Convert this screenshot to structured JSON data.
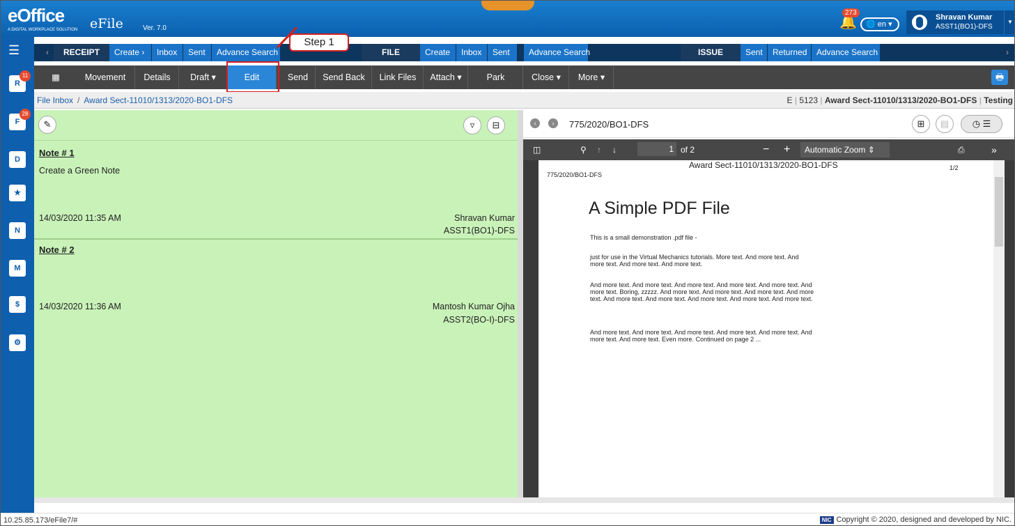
{
  "app": {
    "logo_text": "eOffice",
    "logo_tagline": "A DIGITAL WORKPLACE SOLUTION",
    "product": "eFile",
    "version": "Ver. 7.0"
  },
  "header": {
    "notification_count": "273",
    "language": "en",
    "user_name": "Shravan Kumar",
    "user_role": "ASST1(BO1)-DFS"
  },
  "sidebar": {
    "badges": {
      "receipt": "11",
      "file": "28"
    }
  },
  "nav1": {
    "receipt": {
      "section": "RECEIPT",
      "create": "Create ›",
      "inbox": "Inbox",
      "sent": "Sent",
      "advance_search": "Advance Search"
    },
    "file": {
      "section": "FILE",
      "create": "Create",
      "inbox": "Inbox",
      "sent": "Sent",
      "advance_search": "Advance Search"
    },
    "issue": {
      "section": "ISSUE",
      "sent": "Sent",
      "returned": "Returned",
      "advance_search": "Advance Search"
    }
  },
  "nav2": {
    "movement": "Movement",
    "details": "Details",
    "draft": "Draft ▾",
    "edit": "Edit",
    "send": "Send",
    "send_back": "Send Back",
    "link_files": "Link Files",
    "attach": "Attach ▾",
    "park": "Park",
    "close": "Close ▾",
    "more": "More ▾"
  },
  "annotation": {
    "step": "Step 1"
  },
  "breadcrumb": {
    "root": "File Inbox",
    "current": "Award Sect-11010/1313/2020-BO1-DFS",
    "right_prefix": "E",
    "right_num": "5123",
    "right_file": "Award Sect-11010/1313/2020-BO1-DFS",
    "right_tag": "Testing"
  },
  "notes": [
    {
      "title": "Note # 1",
      "text": "Create a Green Note",
      "date": "14/03/2020 11:35 AM",
      "author": "Shravan Kumar",
      "role": "ASST1(BO1)-DFS"
    },
    {
      "title": "Note # 2",
      "text": "",
      "date": "14/03/2020 11:36 AM",
      "author": "Mantosh Kumar Ojha",
      "role": "ASST2(BO-I)-DFS"
    }
  ],
  "pdf": {
    "name": "775/2020/BO1-DFS",
    "page_current": "1",
    "page_total": "of 2",
    "zoom": "Automatic Zoom",
    "header_left": "775/2020/BO1-DFS",
    "header_center": "Award Sect-11010/1313/2020-BO1-DFS",
    "header_right": "1/2",
    "title": "A Simple PDF File",
    "para1": "This is a small demonstration .pdf file -",
    "para2": "just for use in the Virtual Mechanics tutorials. More text. And more text. And more text. And more text. And more text.",
    "para3": "And more text. And more text. And more text. And more text. And more text. And more text. Boring, zzzzz. And more text. And more text. And more text. And more text. And more text. And more text. And more text. And more text. And more text.",
    "para4": "And more text. And more text. And more text. And more text. And more text. And more text. And more text. Even more. Continued on page 2 ..."
  },
  "footer": {
    "url": "10.25.85.173/eFile7/#",
    "nic": "NIC",
    "copyright": "Copyright © 2020, designed and developed by NIC."
  },
  "colors": {
    "header_blue": "#0b5fae",
    "note_green": "#c9f2b9",
    "edit_blue": "#2c86d8",
    "annotation_red": "#d22020"
  }
}
